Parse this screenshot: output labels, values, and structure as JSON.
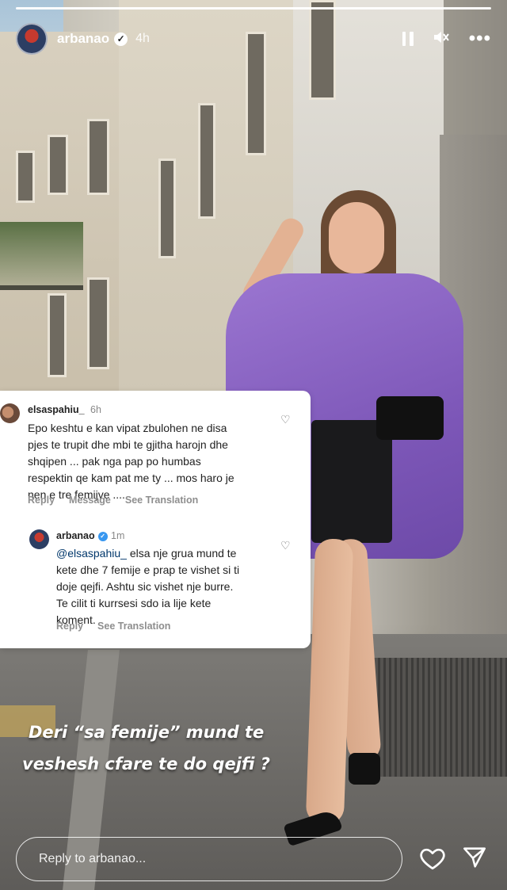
{
  "header": {
    "username": "arbanao",
    "verified_icon": "verified-badge-icon",
    "time": "4h",
    "controls": [
      "pause-icon",
      "mute-icon",
      "more-icon"
    ]
  },
  "comments": [
    {
      "username": "elsaspahiu_",
      "time": "6h",
      "text_lines": [
        "Epo keshtu e kan vipat zbulohen ne disa",
        "pjes te trupit dhe mbi te gjitha harojn dhe",
        "shqipen ... pak nga pap po humbas",
        "respektin qe kam pat me ty ... mos haro je",
        "nen e tre femijve ...."
      ],
      "actions": [
        "Reply",
        "Message",
        "See Translation"
      ]
    },
    {
      "username": "arbanao",
      "time": "1m",
      "mention": "@elsaspahiu_",
      "text_lines": [
        " elsa nje grua mund te",
        "kete dhe 7 femije e prap te vishet si ti",
        "doje qejfi. Ashtu sic vishet nje burre.",
        "Te cilit ti kurrsesi sdo ia lije kete",
        "koment."
      ],
      "actions": [
        "Reply",
        "See Translation"
      ]
    }
  ],
  "caption": {
    "line1": "Deri “sa femije” mund te",
    "line2": "veshesh cfare te do qejfi ?"
  },
  "reply_bar": {
    "placeholder": "Reply to arbanao...",
    "icons": [
      "heart-icon",
      "send-icon"
    ]
  }
}
